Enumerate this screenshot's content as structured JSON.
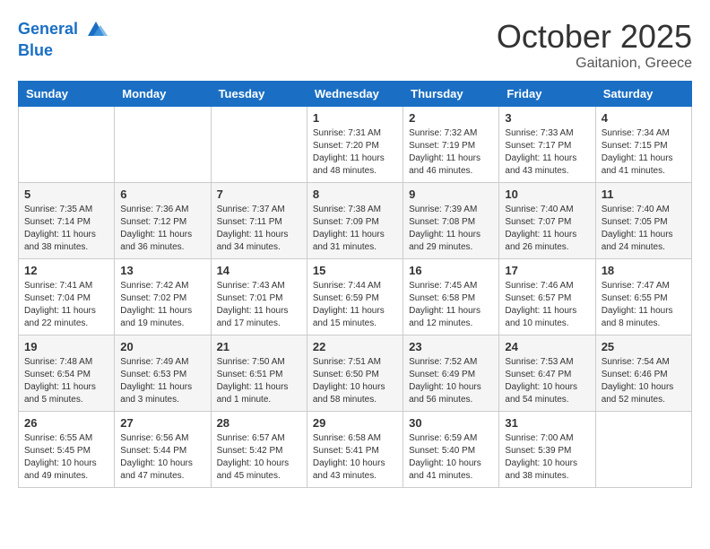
{
  "header": {
    "logo_line1": "General",
    "logo_line2": "Blue",
    "month": "October 2025",
    "location": "Gaitanion, Greece"
  },
  "columns": [
    "Sunday",
    "Monday",
    "Tuesday",
    "Wednesday",
    "Thursday",
    "Friday",
    "Saturday"
  ],
  "weeks": [
    [
      {
        "day": "",
        "info": ""
      },
      {
        "day": "",
        "info": ""
      },
      {
        "day": "",
        "info": ""
      },
      {
        "day": "1",
        "info": "Sunrise: 7:31 AM\nSunset: 7:20 PM\nDaylight: 11 hours\nand 48 minutes."
      },
      {
        "day": "2",
        "info": "Sunrise: 7:32 AM\nSunset: 7:19 PM\nDaylight: 11 hours\nand 46 minutes."
      },
      {
        "day": "3",
        "info": "Sunrise: 7:33 AM\nSunset: 7:17 PM\nDaylight: 11 hours\nand 43 minutes."
      },
      {
        "day": "4",
        "info": "Sunrise: 7:34 AM\nSunset: 7:15 PM\nDaylight: 11 hours\nand 41 minutes."
      }
    ],
    [
      {
        "day": "5",
        "info": "Sunrise: 7:35 AM\nSunset: 7:14 PM\nDaylight: 11 hours\nand 38 minutes."
      },
      {
        "day": "6",
        "info": "Sunrise: 7:36 AM\nSunset: 7:12 PM\nDaylight: 11 hours\nand 36 minutes."
      },
      {
        "day": "7",
        "info": "Sunrise: 7:37 AM\nSunset: 7:11 PM\nDaylight: 11 hours\nand 34 minutes."
      },
      {
        "day": "8",
        "info": "Sunrise: 7:38 AM\nSunset: 7:09 PM\nDaylight: 11 hours\nand 31 minutes."
      },
      {
        "day": "9",
        "info": "Sunrise: 7:39 AM\nSunset: 7:08 PM\nDaylight: 11 hours\nand 29 minutes."
      },
      {
        "day": "10",
        "info": "Sunrise: 7:40 AM\nSunset: 7:07 PM\nDaylight: 11 hours\nand 26 minutes."
      },
      {
        "day": "11",
        "info": "Sunrise: 7:40 AM\nSunset: 7:05 PM\nDaylight: 11 hours\nand 24 minutes."
      }
    ],
    [
      {
        "day": "12",
        "info": "Sunrise: 7:41 AM\nSunset: 7:04 PM\nDaylight: 11 hours\nand 22 minutes."
      },
      {
        "day": "13",
        "info": "Sunrise: 7:42 AM\nSunset: 7:02 PM\nDaylight: 11 hours\nand 19 minutes."
      },
      {
        "day": "14",
        "info": "Sunrise: 7:43 AM\nSunset: 7:01 PM\nDaylight: 11 hours\nand 17 minutes."
      },
      {
        "day": "15",
        "info": "Sunrise: 7:44 AM\nSunset: 6:59 PM\nDaylight: 11 hours\nand 15 minutes."
      },
      {
        "day": "16",
        "info": "Sunrise: 7:45 AM\nSunset: 6:58 PM\nDaylight: 11 hours\nand 12 minutes."
      },
      {
        "day": "17",
        "info": "Sunrise: 7:46 AM\nSunset: 6:57 PM\nDaylight: 11 hours\nand 10 minutes."
      },
      {
        "day": "18",
        "info": "Sunrise: 7:47 AM\nSunset: 6:55 PM\nDaylight: 11 hours\nand 8 minutes."
      }
    ],
    [
      {
        "day": "19",
        "info": "Sunrise: 7:48 AM\nSunset: 6:54 PM\nDaylight: 11 hours\nand 5 minutes."
      },
      {
        "day": "20",
        "info": "Sunrise: 7:49 AM\nSunset: 6:53 PM\nDaylight: 11 hours\nand 3 minutes."
      },
      {
        "day": "21",
        "info": "Sunrise: 7:50 AM\nSunset: 6:51 PM\nDaylight: 11 hours\nand 1 minute."
      },
      {
        "day": "22",
        "info": "Sunrise: 7:51 AM\nSunset: 6:50 PM\nDaylight: 10 hours\nand 58 minutes."
      },
      {
        "day": "23",
        "info": "Sunrise: 7:52 AM\nSunset: 6:49 PM\nDaylight: 10 hours\nand 56 minutes."
      },
      {
        "day": "24",
        "info": "Sunrise: 7:53 AM\nSunset: 6:47 PM\nDaylight: 10 hours\nand 54 minutes."
      },
      {
        "day": "25",
        "info": "Sunrise: 7:54 AM\nSunset: 6:46 PM\nDaylight: 10 hours\nand 52 minutes."
      }
    ],
    [
      {
        "day": "26",
        "info": "Sunrise: 6:55 AM\nSunset: 5:45 PM\nDaylight: 10 hours\nand 49 minutes."
      },
      {
        "day": "27",
        "info": "Sunrise: 6:56 AM\nSunset: 5:44 PM\nDaylight: 10 hours\nand 47 minutes."
      },
      {
        "day": "28",
        "info": "Sunrise: 6:57 AM\nSunset: 5:42 PM\nDaylight: 10 hours\nand 45 minutes."
      },
      {
        "day": "29",
        "info": "Sunrise: 6:58 AM\nSunset: 5:41 PM\nDaylight: 10 hours\nand 43 minutes."
      },
      {
        "day": "30",
        "info": "Sunrise: 6:59 AM\nSunset: 5:40 PM\nDaylight: 10 hours\nand 41 minutes."
      },
      {
        "day": "31",
        "info": "Sunrise: 7:00 AM\nSunset: 5:39 PM\nDaylight: 10 hours\nand 38 minutes."
      },
      {
        "day": "",
        "info": ""
      }
    ]
  ]
}
